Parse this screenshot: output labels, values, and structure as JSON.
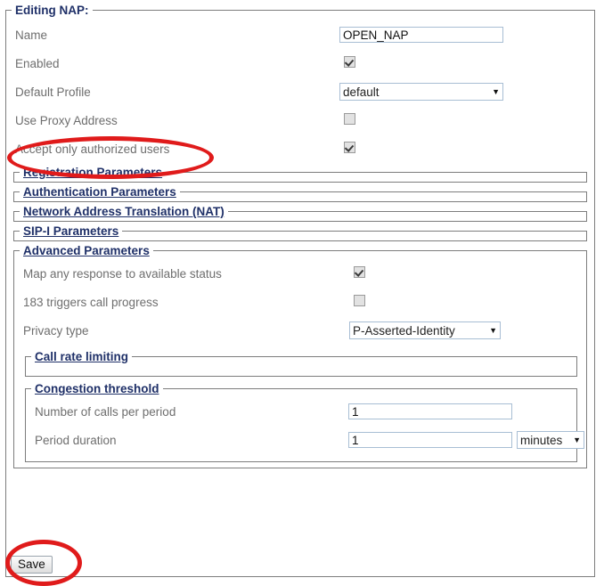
{
  "form": {
    "legend": "Editing NAP:",
    "fields": [
      {
        "label": "Name",
        "type": "text",
        "value": "OPEN_NAP"
      },
      {
        "label": "Enabled",
        "type": "checkbox",
        "checked": true
      },
      {
        "label": "Default Profile",
        "type": "select",
        "value": "default"
      },
      {
        "label": "Use Proxy Address",
        "type": "checkbox",
        "checked": false
      },
      {
        "label": "Accept only authorized users",
        "type": "checkbox",
        "checked": true
      }
    ]
  },
  "collapsed_sections": [
    {
      "title": "Registration Parameters"
    },
    {
      "title": "Authentication Parameters"
    },
    {
      "title": "Network Address Translation (NAT)"
    },
    {
      "title": "SIP-I Parameters"
    }
  ],
  "advanced": {
    "legend": "Advanced Parameters",
    "fields": [
      {
        "label": "Map any response to available status",
        "type": "checkbox",
        "checked": true
      },
      {
        "label": "183 triggers call progress",
        "type": "checkbox",
        "checked": false
      },
      {
        "label": "Privacy type",
        "type": "select",
        "value": "P-Asserted-Identity"
      }
    ],
    "call_rate_limiting": {
      "legend": "Call rate limiting"
    },
    "congestion_threshold": {
      "legend": "Congestion threshold",
      "fields": [
        {
          "label": "Number of calls per period",
          "type": "text",
          "value": "1"
        },
        {
          "label": "Period duration",
          "type": "text",
          "value": "1",
          "unit": "minutes"
        }
      ]
    }
  },
  "actions": {
    "save_label": "Save"
  },
  "annotations": {
    "color": "#e01b1b",
    "highlight_text_color": "#b08a1e",
    "ellipses": [
      {
        "target": "Accept only authorized users"
      },
      {
        "target": "Save"
      }
    ]
  },
  "icons": {
    "caret": "▼",
    "check": "check-icon"
  }
}
